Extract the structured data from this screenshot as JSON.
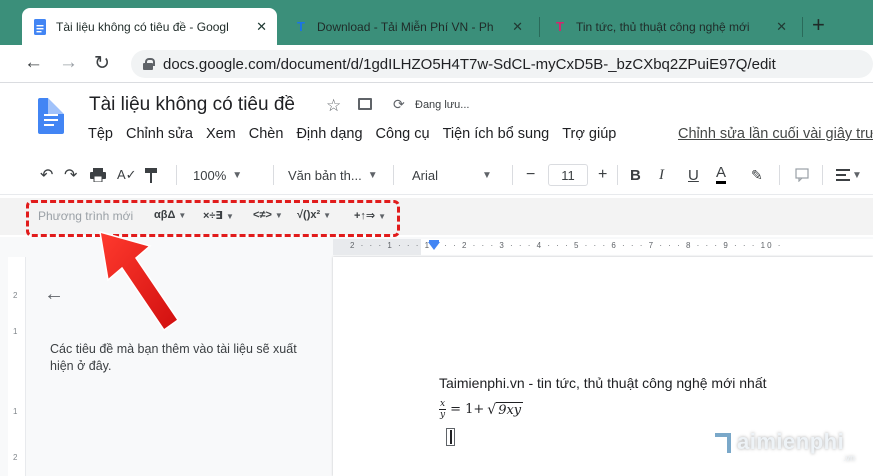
{
  "browser": {
    "tabs": [
      {
        "title": "Tài liệu không có tiêu đề - Googl",
        "favicon": "docs-icon",
        "active": true
      },
      {
        "title": "Download - Tải Miễn Phí VN - Ph",
        "favicon": "taimienphi-icon",
        "active": false
      },
      {
        "title": "Tin tức, thủ thuật công nghệ mới",
        "favicon": "taimienphi-icon",
        "active": false
      }
    ],
    "new_tab": "+",
    "url": "docs.google.com/document/d/1gdILHZO5H4T7w-SdCL-myCxD5B-_bzCXbq2ZPuiE97Q/edit",
    "tab_close": "✕",
    "tab_favicon_letter": "T"
  },
  "docs": {
    "title": "Tài liệu không có tiêu đề",
    "save_status": "Đang lưu...",
    "menu": [
      "Tệp",
      "Chỉnh sửa",
      "Xem",
      "Chèn",
      "Định dạng",
      "Công cụ",
      "Tiện ích bổ sung",
      "Trợ giúp"
    ],
    "last_edit": "Chỉnh sửa lần cuối vài giây trư"
  },
  "toolbar": {
    "zoom": "100%",
    "style": "Văn bản th...",
    "font": "Arial",
    "font_size": "11",
    "minus": "−",
    "plus": "+",
    "bold": "B",
    "italic": "I",
    "underline": "U",
    "text_color": "A"
  },
  "equation_toolbar": {
    "new_equation": "Phương trình mới",
    "groups": [
      "αβΔ",
      "×÷∃",
      "<≠>",
      "√()x²",
      "+↑⇒"
    ]
  },
  "ruler": {
    "labels": "2 · · · 1 · · · 1 · · · 2 · · · 3 · · · 4 · · · 5 · · · 6 · · · 7 · · · 8 · · · 9 · · · 10 ·"
  },
  "outline": {
    "hint": "Các tiêu đề mà bạn thêm vào tài liệu sẽ xuất hiện ở đây."
  },
  "document": {
    "line1": "Taimienphi.vn - tin tức, thủ thuật công nghệ mới nhất",
    "formula": {
      "numerator": "x",
      "denominator": "y",
      "middle": "= 1+",
      "radicand": "9xy"
    }
  },
  "watermark": {
    "text": "aimienphi",
    "suffix": ".vn"
  },
  "colors": {
    "tab_strip": "#3b8f7a",
    "docs_blue": "#4285f4",
    "highlight": "#e11b1b"
  }
}
